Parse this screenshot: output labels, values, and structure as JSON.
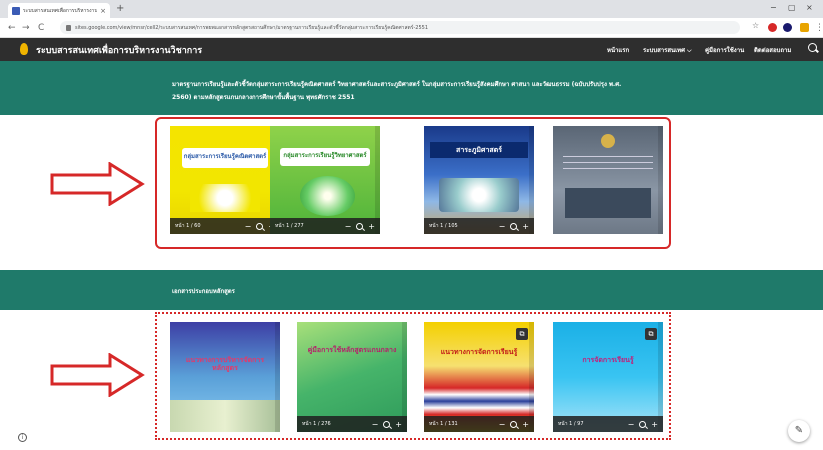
{
  "browser": {
    "tab_title": "ระบบสารสนเทศเพื่อการบริหารงานวิชาการ",
    "tab_close": "×",
    "new_tab": "+",
    "back": "←",
    "forward": "→",
    "reload": "C",
    "url": "sites.google.com/view/mnsr/cell2/ระบบสารสนเทศ/การพยพแอกสารหลักสูตรสถานศึกษา/มาตรฐานการเรียนรู้และตัวชี้วัดกลุ่มสาระการเรียนรู้คณิตศาสตร์-2551",
    "minimize": "−",
    "restore": "▢",
    "close": "×"
  },
  "site": {
    "title": "ระบบสารสนเทศเพื่อการบริหารงานวิชาการ",
    "nav": [
      "หน้าแรก",
      "ระบบสารสนเทศ ⌵",
      "คู่มือการใช้งาน",
      "ติดต่อสอบถาม"
    ]
  },
  "section1": {
    "heading": "มาตรฐานการเรียนรู้และตัวชี้วัดกลุ่มสาระการเรียนรู้คณิตศาสตร์ วิทยาศาสตร์และสาระภูมิศาสตร์ ในกลุ่มสาระการเรียนรู้สังคมศึกษา ศาสนา และวัฒนธรรม (ฉบับปรับปรุง พ.ศ.",
    "heading2": "2560) ตามหลักสูตรแกนกลางการศึกษาขั้นพื้นฐาน พุทธศักราช 2551",
    "books": [
      {
        "title": "กลุ่มสาระการเรียนรู้คณิตศาสตร์",
        "pages": "หน้า 1 / 60"
      },
      {
        "title": "กลุ่มสาระการเรียนรู้วิทยาศาสตร์",
        "pages": "หน้า 1 / 277"
      },
      {
        "title": "สาระภูมิศาสตร์",
        "pages": "หน้า 1 / 105"
      },
      {
        "title": "",
        "pages": ""
      }
    ]
  },
  "section2": {
    "heading": "เอกสารประกอบหลักสูตร",
    "books": [
      {
        "title": "แนวทางการบริหารจัดการหลักสูตร",
        "pages": ""
      },
      {
        "title": "คู่มือการใช้หลักสูตรแกนกลาง",
        "pages": "หน้า 1 / 276"
      },
      {
        "title": "แนวทางการจัดการเรียนรู้",
        "pages": "หน้า 1 / 131"
      },
      {
        "title": "การจัดการเรียนรู้",
        "pages": "หน้า 1 / 97"
      }
    ]
  },
  "viewer": {
    "minus": "−",
    "plus": "+",
    "popout": "⧉"
  },
  "colors": {
    "green": "#1f7a6a",
    "red_frame": "#d62828",
    "header": "#2e2e2e"
  }
}
